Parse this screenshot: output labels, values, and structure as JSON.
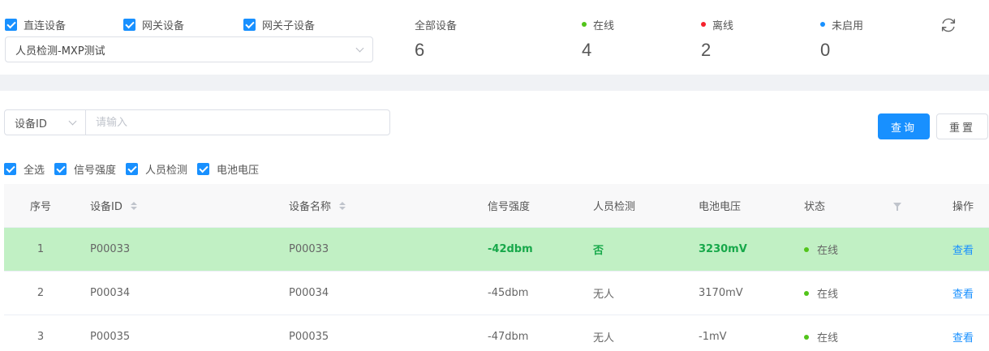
{
  "device_types": [
    {
      "label": "直连设备",
      "checked": true
    },
    {
      "label": "网关设备",
      "checked": true
    },
    {
      "label": "网关子设备",
      "checked": true
    }
  ],
  "project_select": {
    "value": "人员检测-MXP测试"
  },
  "stats": {
    "all": {
      "label": "全部设备",
      "value": "6"
    },
    "online": {
      "label": "在线",
      "value": "4",
      "color": "#52c41a"
    },
    "offline": {
      "label": "离线",
      "value": "2",
      "color": "#f5222d"
    },
    "disabled": {
      "label": "未启用",
      "value": "0",
      "color": "#1890ff"
    }
  },
  "search": {
    "field": "设备ID",
    "placeholder": "请输入"
  },
  "buttons": {
    "query": "查询",
    "reset": "重置"
  },
  "column_checks": [
    {
      "label": "全选",
      "checked": true
    },
    {
      "label": "信号强度",
      "checked": true
    },
    {
      "label": "人员检测",
      "checked": true
    },
    {
      "label": "电池电压",
      "checked": true
    }
  ],
  "table": {
    "headers": {
      "idx": "序号",
      "id": "设备ID",
      "name": "设备名称",
      "signal": "信号强度",
      "person": "人员检测",
      "battery": "电池电压",
      "status": "状态",
      "op": "操作"
    },
    "rows": [
      {
        "idx": "1",
        "id": "P00033",
        "name": "P00033",
        "signal": "-42dbm",
        "person": "否",
        "battery": "3230mV",
        "status": "在线",
        "op": "查看"
      },
      {
        "idx": "2",
        "id": "P00034",
        "name": "P00034",
        "signal": "-45dbm",
        "person": "无人",
        "battery": "3170mV",
        "status": "在线",
        "op": "查看"
      },
      {
        "idx": "3",
        "id": "P00035",
        "name": "P00035",
        "signal": "-47dbm",
        "person": "无人",
        "battery": "-1mV",
        "status": "在线",
        "op": "查看"
      }
    ],
    "highlight_color": "#c1f0c4"
  },
  "icons": {
    "refresh": "refresh-icon",
    "sort": "sort-icon",
    "filter": "filter-icon",
    "chevron": "chevron-down-icon"
  }
}
